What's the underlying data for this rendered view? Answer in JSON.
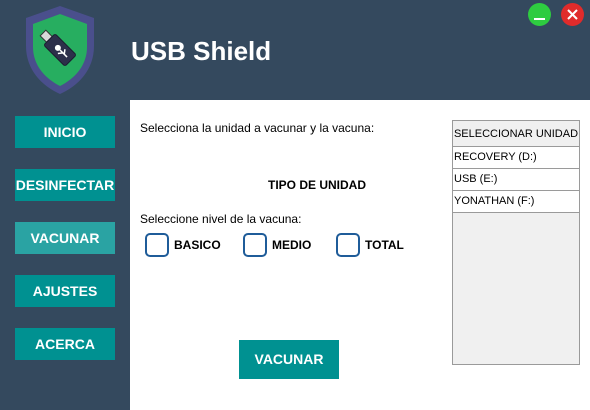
{
  "window": {
    "title": "USB Shield",
    "controls": {
      "minimize_icon": "minimize-icon",
      "close_icon": "close-icon"
    },
    "colors": {
      "minimize": "#2ecc40",
      "close": "#e02b2b"
    }
  },
  "logo": {
    "icon": "usb-shield-logo-icon"
  },
  "sidebar": {
    "items": [
      {
        "label": "INICIO"
      },
      {
        "label": "DESINFECTAR"
      },
      {
        "label": "VACUNAR"
      },
      {
        "label": "AJUSTES"
      },
      {
        "label": "ACERCA"
      }
    ],
    "active": "VACUNAR"
  },
  "main": {
    "prompt": "Selecciona la unidad a vacunar y la vacuna:",
    "tipo_unidad": "TIPO DE UNIDAD",
    "nivel_label": "Seleccione nivel de la vacuna:",
    "levels": [
      {
        "label": "BASICO",
        "checked": false
      },
      {
        "label": "MEDIO",
        "checked": false
      },
      {
        "label": "TOTAL",
        "checked": false
      }
    ],
    "vacunar_button": "VACUNAR"
  },
  "drives": {
    "header": "SELECCIONAR UNIDAD",
    "items": [
      "RECOVERY (D:)",
      "USB (E:)",
      "YONATHAN (F:)"
    ]
  },
  "colors": {
    "background": "#34495e",
    "accent": "#009191",
    "accent_active": "#2aa3a3",
    "checkbox_border": "#1f5c99",
    "shield_green": "#27ae60"
  }
}
